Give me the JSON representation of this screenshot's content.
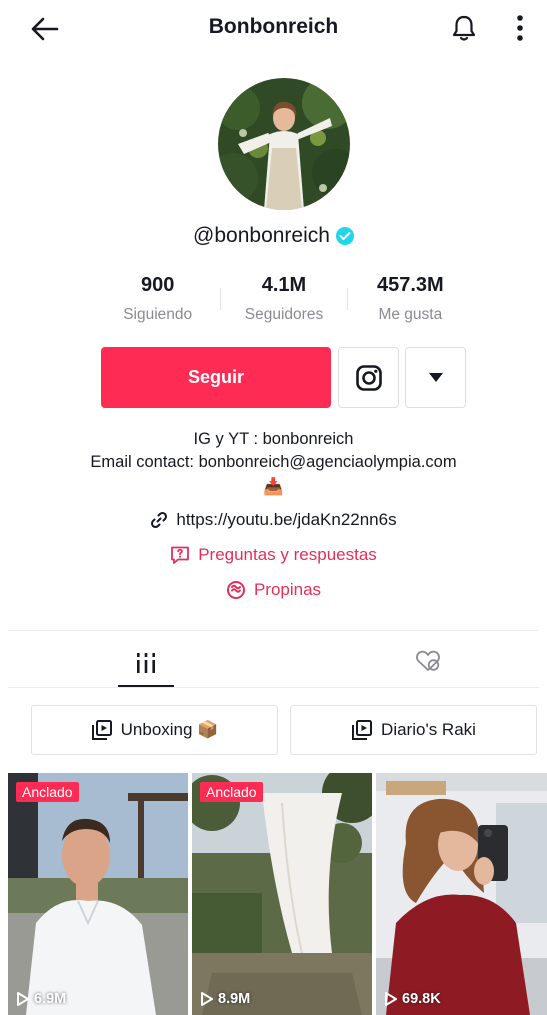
{
  "header": {
    "title": "Bonbonreich",
    "back_icon": "arrow-left-icon",
    "bell_icon": "bell-icon",
    "more_icon": "more-vertical-icon"
  },
  "profile": {
    "handle": "@bonbonreich",
    "verified": true,
    "stats": [
      {
        "value": "900",
        "label": "Siguiendo"
      },
      {
        "value": "4.1M",
        "label": "Seguidores"
      },
      {
        "value": "457.3M",
        "label": "Me gusta"
      }
    ],
    "follow_label": "Seguir",
    "bio_line1": "IG y YT : bonbonreich",
    "bio_line2": "Email contact:  bonbonreich@agenciaolympia.com",
    "bio_emoji": "📥",
    "link": "https://youtu.be/jdaKn22nn6s",
    "qa_label": "Preguntas y respuestas",
    "tips_label": "Propinas"
  },
  "playlists": [
    {
      "label": "Unboxing 📦"
    },
    {
      "label": "Diario's Raki"
    }
  ],
  "videos": [
    {
      "pinned": "Anclado",
      "views": "6.9M"
    },
    {
      "pinned": "Anclado",
      "views": "8.9M"
    },
    {
      "pinned": "",
      "views": "69.8K"
    }
  ],
  "colors": {
    "accent": "#fe2c55",
    "qa_text": "#e3305a",
    "verified": "#20d5ec",
    "muted": "#8a8b91"
  }
}
